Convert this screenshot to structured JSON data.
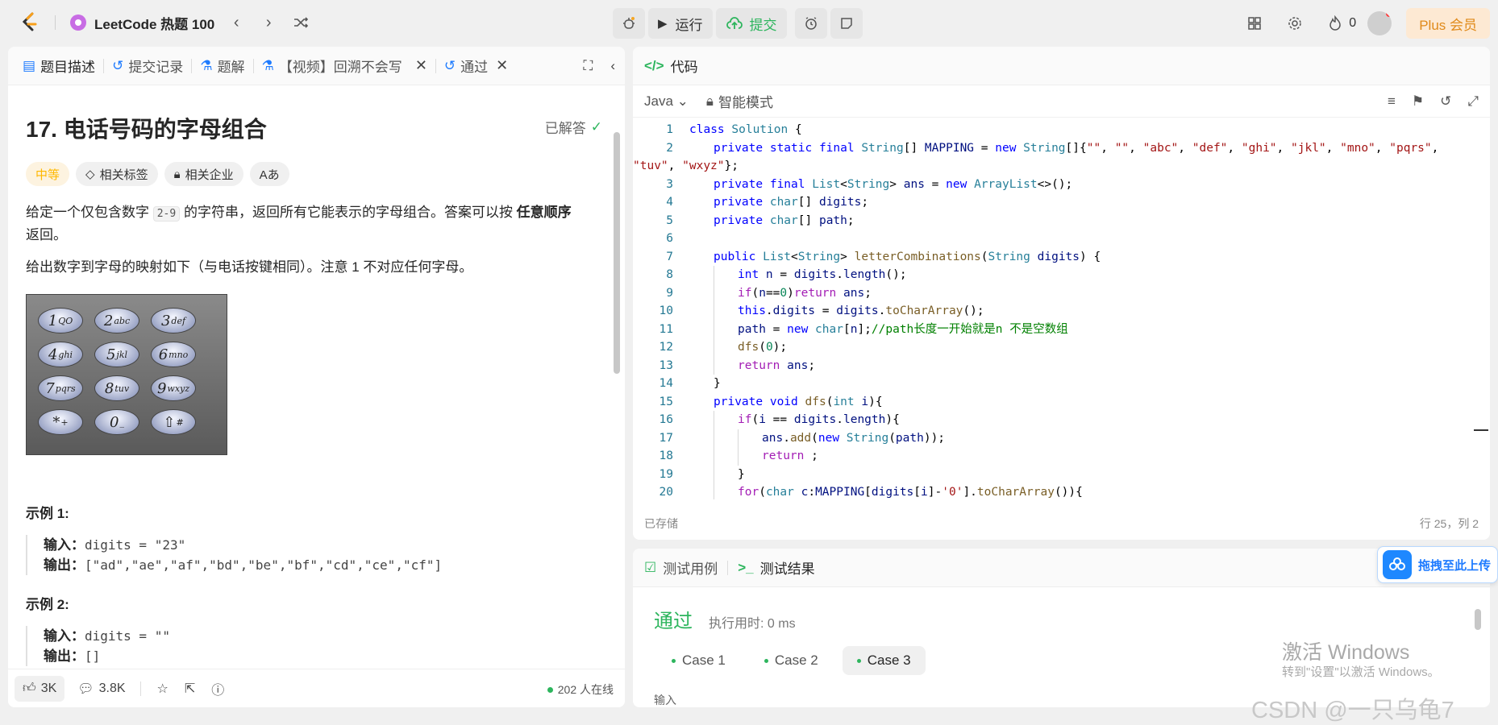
{
  "topbar": {
    "problem_list_title": "LeetCode 热题 100",
    "run_label": "运行",
    "submit_label": "提交",
    "streak_count": "0",
    "plus_label": "Plus 会员"
  },
  "left_tabs": [
    {
      "label": "题目描述"
    },
    {
      "label": "提交记录"
    },
    {
      "label": "题解"
    },
    {
      "label": "【视频】回溯不会写"
    },
    {
      "label": "通过"
    }
  ],
  "problem": {
    "title": "17. 电话号码的字母组合",
    "solved_label": "已解答",
    "difficulty": "中等",
    "tag_related": "相关标签",
    "tag_company": "相关企业",
    "tag_font": "Aあ",
    "desc_1a": "给定一个仅包含数字 ",
    "desc_1_code": "2-9",
    "desc_1b": " 的字符串，返回所有它能表示的字母组合。答案可以按 ",
    "desc_1_bold": "任意顺序",
    "desc_1c": " 返回。",
    "desc_2": "给出数字到字母的映射如下（与电话按键相同）。注意 1 不对应任何字母。",
    "keys": [
      {
        "digit": "1",
        "letters": "QO"
      },
      {
        "digit": "2",
        "letters": "abc"
      },
      {
        "digit": "3",
        "letters": "def"
      },
      {
        "digit": "4",
        "letters": "ghi"
      },
      {
        "digit": "5",
        "letters": "jkl"
      },
      {
        "digit": "6",
        "letters": "mno"
      },
      {
        "digit": "7",
        "letters": "pqrs"
      },
      {
        "digit": "8",
        "letters": "tuv"
      },
      {
        "digit": "9",
        "letters": "wxyz"
      },
      {
        "digit": "*",
        "letters": "+"
      },
      {
        "digit": "0",
        "letters": "_"
      },
      {
        "digit": "⇧",
        "letters": "#"
      }
    ],
    "example1_title": "示例 1:",
    "example1_input_label": "输入：",
    "example1_input": "digits = \"23\"",
    "example1_output_label": "输出：",
    "example1_output": "[\"ad\",\"ae\",\"af\",\"bd\",\"be\",\"bf\",\"cd\",\"ce\",\"cf\"]",
    "example2_title": "示例 2:",
    "example2_input_label": "输入：",
    "example2_input": "digits = \"\"",
    "example2_output_label": "输出：",
    "example2_output": "[]"
  },
  "left_footer": {
    "likes": "3K",
    "comments": "3.8K",
    "online": "202 人在线"
  },
  "code_panel": {
    "title": "代码",
    "language": "Java",
    "mode": "智能模式",
    "saved": "已存储",
    "cursor": "行 25，列 2"
  },
  "test_panel": {
    "tab_cases": "测试用例",
    "tab_result": "测试结果",
    "status": "通过",
    "runtime": "执行用时: 0 ms",
    "cases": [
      "Case 1",
      "Case 2",
      "Case 3"
    ],
    "input_label": "输入"
  },
  "drag_widget": {
    "label": "拖拽至此上传"
  },
  "watermark": {
    "activate_title": "激活 Windows",
    "activate_sub": "转到\"设置\"以激活 Windows。",
    "csdn": "CSDN @一只乌龟7"
  }
}
